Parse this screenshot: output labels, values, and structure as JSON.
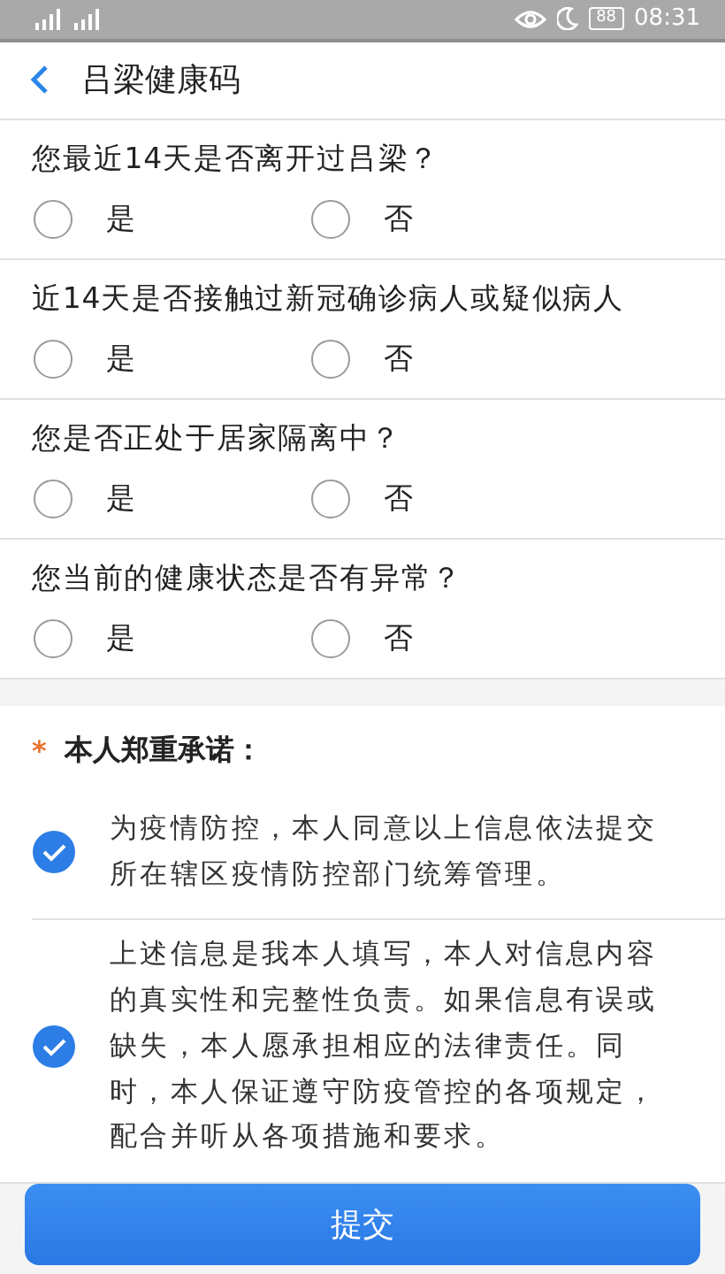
{
  "status_bar": {
    "battery": "88",
    "time": "08:31"
  },
  "header": {
    "title": "吕梁健康码"
  },
  "questions": [
    {
      "text": "您最近14天是否离开过吕梁？",
      "options": [
        {
          "label": "是",
          "selected": false
        },
        {
          "label": "否",
          "selected": false
        }
      ]
    },
    {
      "text": "近14天是否接触过新冠确诊病人或疑似病人",
      "options": [
        {
          "label": "是",
          "selected": false
        },
        {
          "label": "否",
          "selected": false
        }
      ]
    },
    {
      "text": "您是否正处于居家隔离中？",
      "options": [
        {
          "label": "是",
          "selected": false
        },
        {
          "label": "否",
          "selected": false
        }
      ]
    },
    {
      "text": "您当前的健康状态是否有异常？",
      "options": [
        {
          "label": "是",
          "selected": false
        },
        {
          "label": "否",
          "selected": false
        }
      ]
    }
  ],
  "promise": {
    "required_mark": "*",
    "title": "本人郑重承诺：",
    "items": [
      {
        "text": "为疫情防控，本人同意以上信息依法提交所在辖区疫情防控部门统筹管理。",
        "checked": true
      },
      {
        "text": "上述信息是我本人填写，本人对信息内容的真实性和完整性负责。如果信息有误或缺失，本人愿承担相应的法律责任。同时，本人保证遵守防疫管控的各项规定，配合并听从各项措施和要求。",
        "checked": true
      }
    ]
  },
  "submit_button": "提交"
}
